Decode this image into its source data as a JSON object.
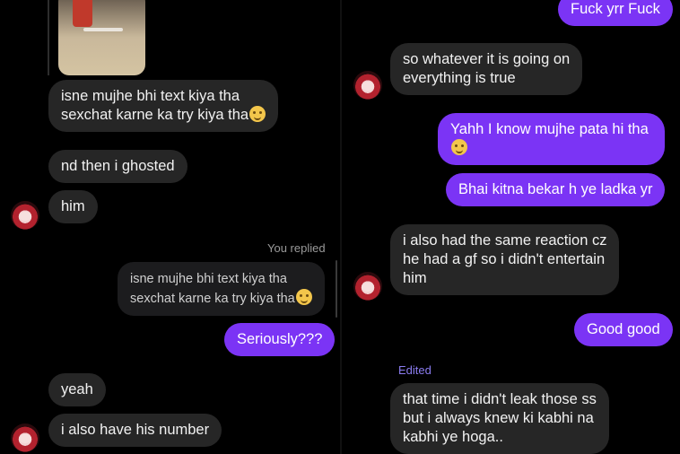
{
  "left": {
    "messages": [
      {
        "text_lines": [
          "isne mujhe bhi text kiya tha",
          "sexchat karne ka try kiya tha"
        ],
        "emoji": "smirk"
      },
      {
        "text": "nd then i ghosted"
      },
      {
        "text": "him"
      },
      {
        "text": "yeah"
      },
      {
        "text": "i also have his number"
      }
    ],
    "reply_meta": "You replied",
    "reply_quote_lines": [
      "isne mujhe bhi text kiya tha",
      "sexchat karne ka try kiya tha"
    ],
    "outgoing": [
      {
        "text": "Seriously???"
      }
    ]
  },
  "right": {
    "outgoing": [
      {
        "text": "Fuck yrr Fuck"
      },
      {
        "text_lines": [
          "Yahh I know mujhe pata hi tha"
        ],
        "emoji": "smile"
      },
      {
        "text": "Bhai kitna bekar h ye ladka yr"
      },
      {
        "text": "Good good"
      }
    ],
    "incoming": [
      {
        "text_lines": [
          "so whatever it is going on",
          "everything is true"
        ]
      },
      {
        "text_lines": [
          "i also had the same reaction cz",
          "he had a gf so i didn't entertain",
          "him"
        ]
      },
      {
        "text_lines": [
          "that time i didn't leak those ss",
          "but i always knew ki kabhi na",
          "kabhi ye hoga.."
        ]
      }
    ],
    "edited_label": "Edited"
  },
  "colors": {
    "outgoing_bubble": "#7b34f5",
    "incoming_bubble": "#262626",
    "background": "#000000",
    "edited": "#8b7cf0"
  }
}
